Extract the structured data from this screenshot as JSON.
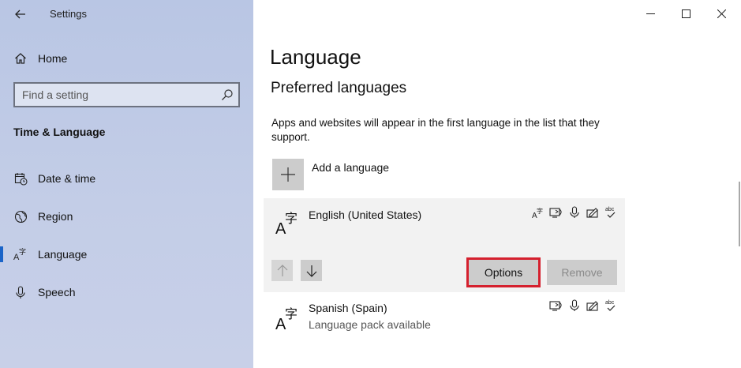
{
  "window": {
    "app_title": "Settings"
  },
  "sidebar": {
    "home_label": "Home",
    "search_placeholder": "Find a setting",
    "section_title": "Time & Language",
    "items": [
      {
        "label": "Date & time",
        "icon": "date-time-icon"
      },
      {
        "label": "Region",
        "icon": "globe-icon"
      },
      {
        "label": "Language",
        "icon": "language-icon",
        "active": true
      },
      {
        "label": "Speech",
        "icon": "microphone-icon"
      }
    ]
  },
  "main": {
    "page_title": "Language",
    "section_title": "Preferred languages",
    "description": "Apps and websites will appear in the first language in the list that they support.",
    "add_language_label": "Add a language",
    "languages": [
      {
        "name": "English (United States)",
        "features": [
          "display-language-icon",
          "text-to-speech-icon",
          "speech-recognition-icon",
          "handwriting-icon",
          "spellcheck-icon"
        ],
        "options_label": "Options",
        "remove_label": "Remove",
        "expanded": true
      },
      {
        "name": "Spanish (Spain)",
        "status": "Language pack available",
        "features": [
          "text-to-speech-icon",
          "speech-recognition-icon",
          "handwriting-icon",
          "spellcheck-icon"
        ]
      }
    ]
  },
  "colors": {
    "accent": "#1a64c8",
    "highlight_box": "#d5202e",
    "sidebar_bg": "#c3cde7"
  }
}
